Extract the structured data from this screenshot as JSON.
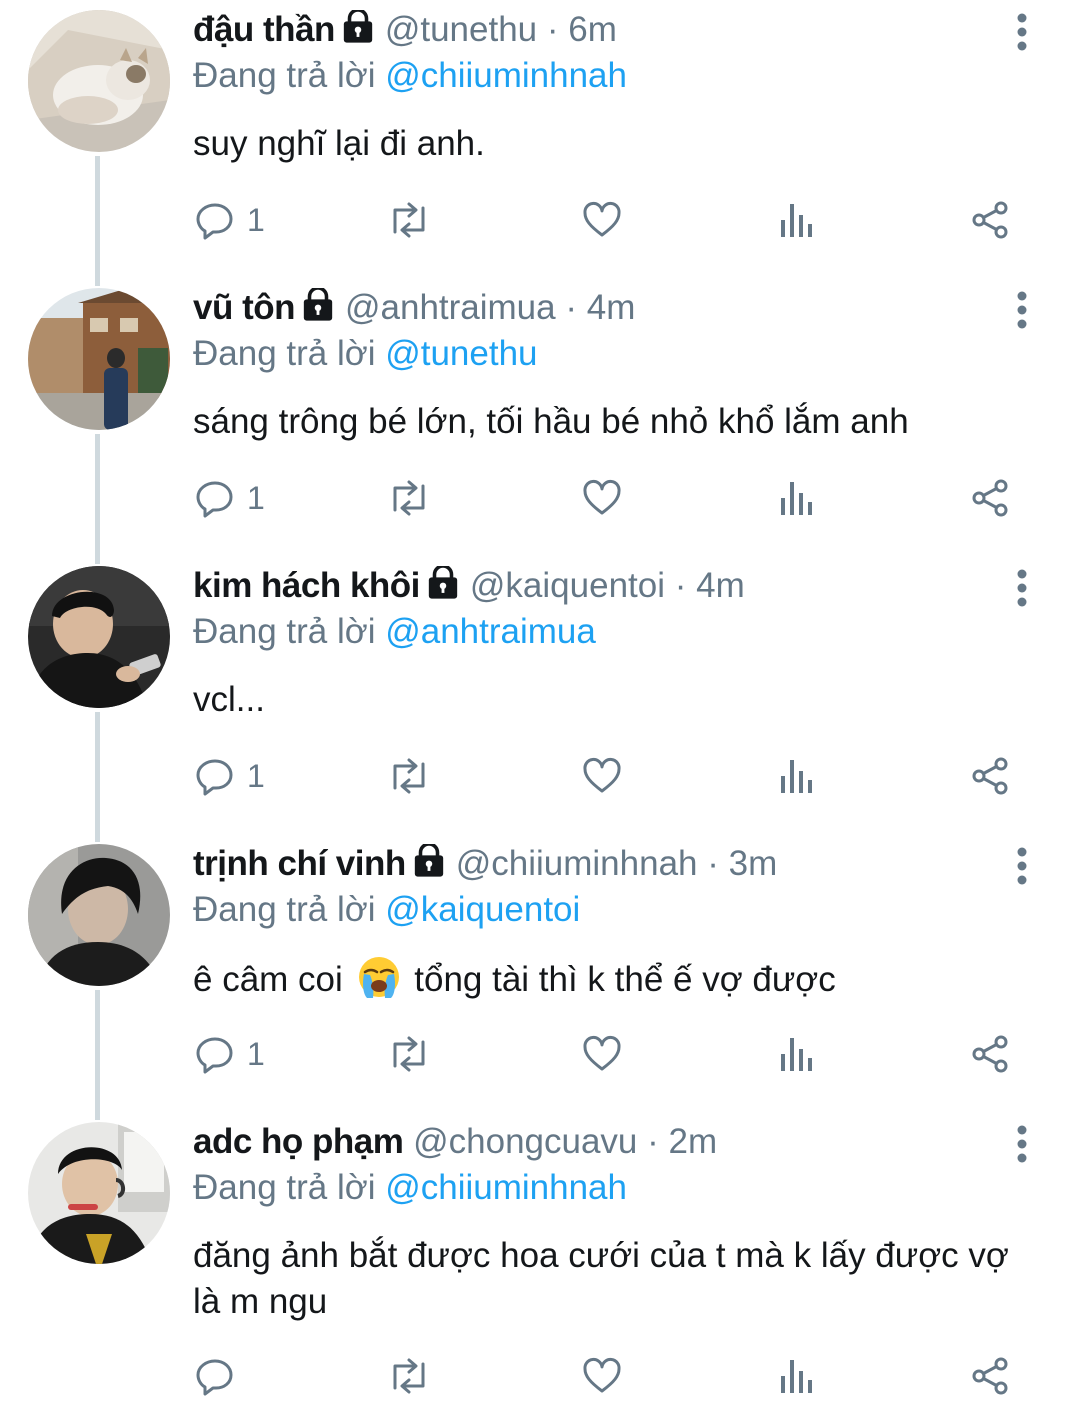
{
  "colors": {
    "accent": "#1da1f2",
    "muted": "#657786",
    "text": "#14171a",
    "icon": "#657786",
    "thread_line": "#cfd9de"
  },
  "icons": {
    "reply": "reply-icon",
    "retweet": "retweet-icon",
    "like": "heart-icon",
    "analytics": "analytics-icon",
    "share": "share-icon",
    "more": "more-vertical-icon",
    "lock": "lock-icon"
  },
  "reply_prefix": "Đang trả lời",
  "tweets": [
    {
      "name": "đậu thần",
      "handle": "@tunethu",
      "time": "· 6m",
      "reply_to": "@chiiuminhnah",
      "text": "suy nghĩ lại đi anh.",
      "reply_count": "1",
      "locked": true
    },
    {
      "name": "vũ tôn",
      "handle": "@anhtraimua",
      "time": "· 4m",
      "reply_to": "@tunethu",
      "text": "sáng trông bé lớn, tối hầu bé nhỏ khổ lắm anh",
      "reply_count": "1",
      "locked": true
    },
    {
      "name": "kim hách khôi",
      "handle": "@kaiquentoi",
      "time": "· 4m",
      "reply_to": "@anhtraimua",
      "text": "vcl...",
      "reply_count": "1",
      "locked": true
    },
    {
      "name": "trịnh chí vinh",
      "handle": "@chiiuminhnah",
      "time": "· 3m",
      "reply_to": "@kaiquentoi",
      "text_before": "ê câm coi",
      "text_emoji": "loudly-crying-face-emoji",
      "text_after": "tổng tài thì k thể ế vợ được",
      "reply_count": "1",
      "locked": true
    },
    {
      "name": "adc họ phạm",
      "handle": "@chongcuavu",
      "time": "· 2m",
      "reply_to": "@chiiuminhnah",
      "text": "đăng ảnh bắt được hoa cưới của t mà k lấy được vợ là m ngu",
      "reply_count": "",
      "locked": false
    }
  ]
}
